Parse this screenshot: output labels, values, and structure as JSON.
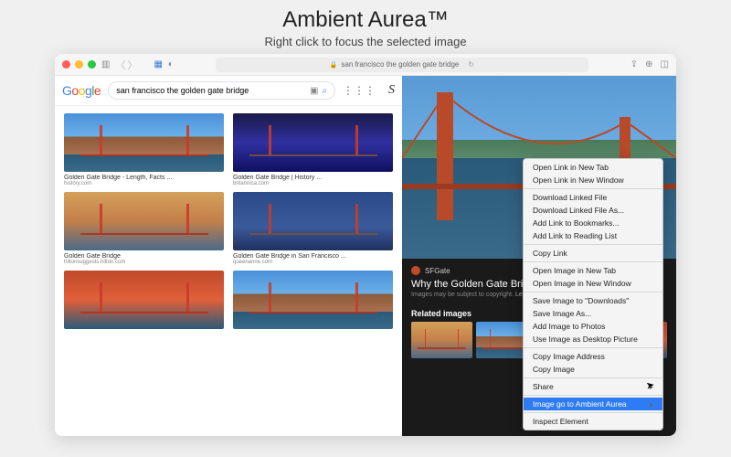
{
  "page": {
    "title": "Ambient Aurea™",
    "subtitle": "Right click to focus the selected image"
  },
  "url": {
    "text": "san francisco the golden gate bridge"
  },
  "search": {
    "query": "san francisco the golden gate bridge",
    "profile": "S"
  },
  "thumbs": [
    {
      "cap": "Golden Gate Bridge - Length, Facts ...",
      "src": "history.com",
      "klass": "bridge-day"
    },
    {
      "cap": "Golden Gate Bridge | History ...",
      "src": "britannica.com",
      "klass": "bridge-night"
    },
    {
      "cap": "Golden Gate Bridge",
      "src": "hiltonsuggests.hilton.com",
      "klass": "bridge-sunset"
    },
    {
      "cap": "Golden Gate Bridge in San Francisco ...",
      "src": "queenanne.com",
      "klass": "bridge-blue"
    },
    {
      "cap": "",
      "src": "",
      "klass": "bridge-orange"
    },
    {
      "cap": "",
      "src": "",
      "klass": "bridge-day"
    }
  ],
  "panel": {
    "source": "SFGate",
    "title": "Why the Golden Gate Bridge made strange...",
    "copyright": "Images may be subject to copyright.",
    "learn": "Learn More",
    "related": "Related images"
  },
  "menu": {
    "items": [
      {
        "t": "Open Link in New Tab"
      },
      {
        "t": "Open Link in New Window"
      },
      {
        "sep": true
      },
      {
        "t": "Download Linked File"
      },
      {
        "t": "Download Linked File As..."
      },
      {
        "t": "Add Link to Bookmarks..."
      },
      {
        "t": "Add Link to Reading List"
      },
      {
        "sep": true
      },
      {
        "t": "Copy Link"
      },
      {
        "sep": true
      },
      {
        "t": "Open Image in New Tab"
      },
      {
        "t": "Open Image in New Window"
      },
      {
        "sep": true
      },
      {
        "t": "Save Image to \"Downloads\""
      },
      {
        "t": "Save Image As..."
      },
      {
        "t": "Add Image to Photos"
      },
      {
        "t": "Use Image as Desktop Picture"
      },
      {
        "sep": true
      },
      {
        "t": "Copy Image Address"
      },
      {
        "t": "Copy Image"
      },
      {
        "sep": true
      },
      {
        "t": "Share",
        "sub": true
      },
      {
        "sep": true
      },
      {
        "t": "Image go to Ambient Aurea",
        "sel": true,
        "sub": true
      },
      {
        "sep": true
      },
      {
        "t": "Inspect Element"
      }
    ]
  }
}
